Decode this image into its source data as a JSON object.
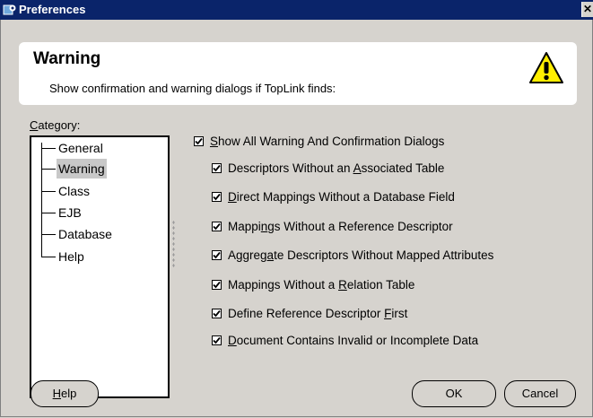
{
  "window": {
    "title": "Preferences",
    "close_glyph": "✕"
  },
  "header": {
    "title": "Warning",
    "description": "Show confirmation and warning dialogs if TopLink finds:",
    "icon": "warning-icon"
  },
  "category": {
    "label_prefix": "",
    "label_mnemonic": "C",
    "label_rest": "ategory:",
    "items": [
      {
        "label": "General",
        "selected": false
      },
      {
        "label": "Warning",
        "selected": true
      },
      {
        "label": "Class",
        "selected": false
      },
      {
        "label": "EJB",
        "selected": false
      },
      {
        "label": "Database",
        "selected": false
      },
      {
        "label": "Help",
        "selected": false
      }
    ]
  },
  "options": {
    "main": {
      "pre": "",
      "mn": "S",
      "post": "how All Warning And Confirmation Dialogs",
      "checked": true
    },
    "items": [
      {
        "pre": "Descriptors Without an ",
        "mn": "A",
        "post": "ssociated Table",
        "checked": true
      },
      {
        "pre": "",
        "mn": "D",
        "post": "irect Mappings Without a Database Field",
        "checked": true
      },
      {
        "pre": "Mappi",
        "mn": "n",
        "post": "gs Without a Reference Descriptor",
        "checked": true
      },
      {
        "pre": "Aggreg",
        "mn": "a",
        "post": "te Descriptors Without Mapped Attributes",
        "checked": true
      },
      {
        "pre": "Mappings Without a ",
        "mn": "R",
        "post": "elation Table",
        "checked": true
      },
      {
        "pre": "Define Reference Descriptor ",
        "mn": "F",
        "post": "irst",
        "checked": true
      },
      {
        "pre": "",
        "mn": "D",
        "post": "ocument Contains Invalid or Incomplete Data",
        "checked": true
      }
    ]
  },
  "buttons": {
    "help": {
      "pre": "",
      "mn": "H",
      "post": "elp"
    },
    "ok": "OK",
    "cancel": "Cancel"
  }
}
